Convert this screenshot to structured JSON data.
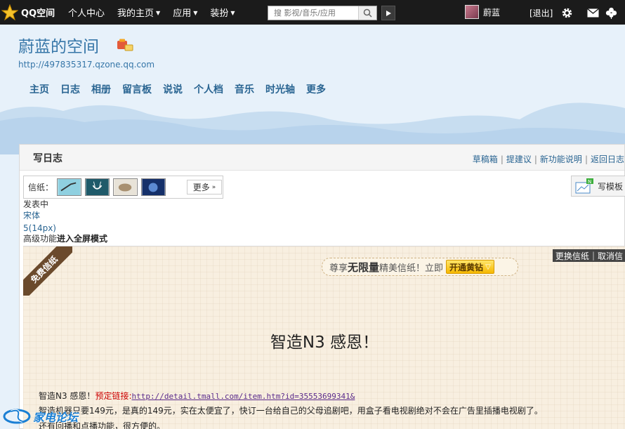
{
  "topbar": {
    "logo_text": "QQ空间",
    "nav": [
      {
        "label": "个人中心",
        "caret": false
      },
      {
        "label": "我的主页",
        "caret": true
      },
      {
        "label": "应用",
        "caret": true
      },
      {
        "label": "装扮",
        "caret": true
      }
    ],
    "search_placeholder": "搜 影视/音乐/应用",
    "username": "蔚蓝",
    "logout": "[退出]"
  },
  "header": {
    "title": "蔚蓝的空间",
    "url": "http://497835317.qzone.qq.com",
    "nav": [
      "主页",
      "日志",
      "相册",
      "留言板",
      "说说",
      "个人档",
      "音乐",
      "时光轴",
      "更多"
    ]
  },
  "panel": {
    "title": "写日志",
    "links": [
      "草稿箱",
      "提建议",
      "新功能说明",
      "返回日志"
    ],
    "stationery_label": "信纸：",
    "more_label": "更多",
    "template_label": "写模板",
    "status": "发表中",
    "font": "宋体",
    "font_size": "5(14px)",
    "advanced_prefix": "高级功能",
    "fullscreen": "进入全屏模式"
  },
  "editor": {
    "ribbon": "免费信纸",
    "swap": "更换信纸",
    "cancel": "取消信",
    "promo_prefix": "尊享",
    "promo_big": "无限量",
    "promo_suffix": "精美信纸！立即",
    "promo_button": "开通黄钻",
    "heading": "智造N3 感恩！",
    "line1_prefix": "智造N3 感恩！",
    "line1_red": "预定链接:",
    "line1_link": "http://detail.tmall.com/item.htm?id=35553699341&",
    "line2": "智造机器只要149元，是真的149元，实在太便宜了，快订一台给自己的父母追剧吧，用盒子看电视剧绝对不会在广告里插播电视剧了。",
    "line3": "还有回播和点播功能，很方便的。"
  },
  "watermark": "家电论坛",
  "colors": {
    "accent": "#2a6592",
    "topbar": "#1b1b1b",
    "paper": "#f8efe0"
  }
}
